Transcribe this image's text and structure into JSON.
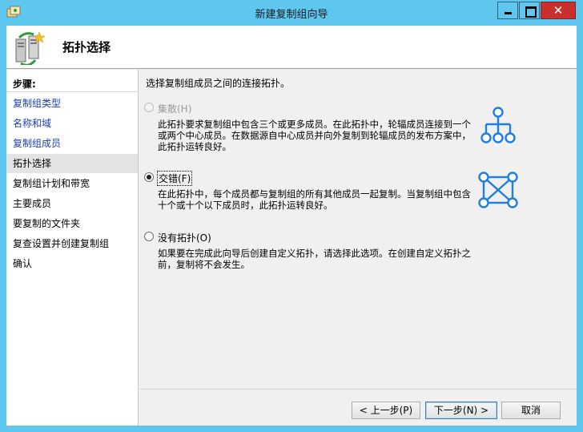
{
  "window": {
    "title": "新建复制组向导",
    "close_symbol": "✕"
  },
  "header": {
    "title": "拓扑选择"
  },
  "sidebar": {
    "steps_title": "步骤:",
    "steps": [
      {
        "label": "复制组类型",
        "state": "link"
      },
      {
        "label": "名称和域",
        "state": "link"
      },
      {
        "label": "复制组成员",
        "state": "link"
      },
      {
        "label": "拓扑选择",
        "state": "current"
      },
      {
        "label": "复制组计划和带宽",
        "state": "pending"
      },
      {
        "label": "主要成员",
        "state": "pending"
      },
      {
        "label": "要复制的文件夹",
        "state": "pending"
      },
      {
        "label": "复查设置并创建复制组",
        "state": "pending"
      },
      {
        "label": "确认",
        "state": "pending"
      }
    ]
  },
  "content": {
    "intro": "选择复制组成员之间的连接拓扑。",
    "options": [
      {
        "label": "集散(H)",
        "description": "此拓扑要求复制组中包含三个或更多成员。在此拓扑中，轮辐成员连接到一个或两个中心成员。在数据源自中心成员并向外复制到轮辐成员的发布方案中，此拓扑运转良好。",
        "enabled": false,
        "selected": false,
        "icon": "hub-spoke-icon"
      },
      {
        "label": "交错(F)",
        "description": "在此拓扑中，每个成员都与复制组的所有其他成员一起复制。当复制组中包含十个或十个以下成员时，此拓扑运转良好。",
        "enabled": true,
        "selected": true,
        "icon": "full-mesh-icon"
      },
      {
        "label": "没有拓扑(O)",
        "description": "如果要在完成此向导后创建自定义拓扑，请选择此选项。在创建自定义拓扑之前，复制将不会发生。",
        "enabled": true,
        "selected": false,
        "icon": ""
      }
    ]
  },
  "buttons": {
    "prev": "< 上一步(P)",
    "next": "下一步(N) >",
    "cancel": "取消"
  },
  "colors": {
    "titlebar": "#5ec7ef",
    "close_button": "#c9302c",
    "link": "#1d3fb0",
    "topology_icon": "#1e7fe0"
  }
}
